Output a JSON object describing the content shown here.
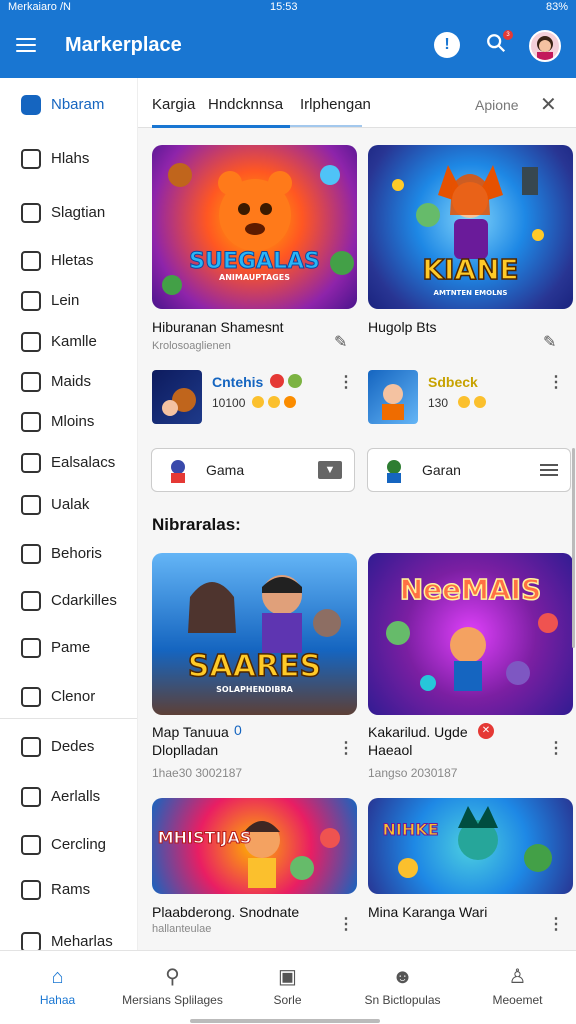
{
  "status_bar": {
    "left": "Merkaiaro /N",
    "time": "15:53",
    "right": "83%"
  },
  "app_bar": {
    "title": "Markerplace",
    "notify_icon": "info-icon",
    "badge": "3"
  },
  "colors": {
    "primary": "#1976d2",
    "accent_red": "#e53935"
  },
  "sidebar": {
    "items": [
      {
        "label": "Nbaram",
        "icon": "home-icon"
      },
      {
        "label": "Hlahs",
        "icon": "tag-icon"
      },
      {
        "label": "Slagtian",
        "icon": "layers-icon"
      },
      {
        "label": "Hletas",
        "icon": "puzzle-icon"
      },
      {
        "label": "Lein",
        "icon": "inbox-icon"
      },
      {
        "label": "Kamlle",
        "icon": "rocket-icon"
      },
      {
        "label": "Maids",
        "icon": "grid-icon"
      },
      {
        "label": "Mloins",
        "icon": "mail-icon"
      },
      {
        "label": "Ealsalacs",
        "icon": "envelope-icon"
      },
      {
        "label": "Ualak",
        "icon": "calendar-icon"
      },
      {
        "label": "Behoris",
        "icon": "badge-icon"
      },
      {
        "label": "Cdarkilles",
        "icon": "folder-icon"
      },
      {
        "label": "Pame",
        "icon": "book-icon"
      },
      {
        "label": "Clenor",
        "icon": "chat-icon"
      },
      {
        "label": "Dedes",
        "icon": "smile-icon"
      },
      {
        "label": "Aerlalls",
        "icon": "pencil-icon"
      },
      {
        "label": "Cercling",
        "icon": "clipboard-icon"
      },
      {
        "label": "Rams",
        "icon": "briefcase-icon"
      },
      {
        "label": "Meharlas",
        "icon": "tag-icon"
      }
    ]
  },
  "tabs": {
    "items": [
      "Kargia",
      "Hndcknnsa",
      "Irlphengan"
    ],
    "right_label": "Apione"
  },
  "featured": [
    {
      "title": "Hiburanan Shamesnt",
      "subtitle": "Krolosoaglienen",
      "logo": "SUEGALAS",
      "logo_sub": "ANIMAUPTAGES"
    },
    {
      "title": "Hugolp Bts",
      "subtitle": "",
      "logo": "KIANE",
      "logo_sub": "AMTNTEN EMOLNS"
    }
  ],
  "mini": [
    {
      "title": "Cntehis",
      "meta": "10100 ",
      "title_color": "#1565c0"
    },
    {
      "title": "Sdbeck",
      "meta": "130 ",
      "title_color": "#c7a200"
    }
  ],
  "pickers": [
    {
      "label": "Gama"
    },
    {
      "label": "Garan"
    }
  ],
  "section": {
    "title": "Nibraralas:"
  },
  "grid": [
    {
      "title": "Map Tanuua",
      "title2": "Dloplladan",
      "meta": "1hae30 3002187",
      "logo": "SAARES",
      "logo_sub": "SOLAPHENDIBRA"
    },
    {
      "title": "Kakarilud. Ugde",
      "title2": "Haeaol",
      "meta": "1angso 2030187",
      "logo": "NeeMAIS",
      "logo_sub": ""
    },
    {
      "title": "Plaabderong. Snodnate",
      "title2": "",
      "meta": "hallanteulae",
      "logo": "MHISTIJAS",
      "logo_sub": ""
    },
    {
      "title": "Mina Karanga Wari",
      "title2": "",
      "meta": "",
      "logo": "NIHKE",
      "logo_sub": ""
    }
  ],
  "bottom_nav": [
    {
      "label": "Hahaa",
      "icon": "home-icon"
    },
    {
      "label": "Mersians Splilages",
      "icon": "search-icon"
    },
    {
      "label": "Sorle",
      "icon": "square-icon"
    },
    {
      "label": "Sn Bictlopulas",
      "icon": "person-icon"
    },
    {
      "label": "Meoemet",
      "icon": "user-icon"
    }
  ]
}
